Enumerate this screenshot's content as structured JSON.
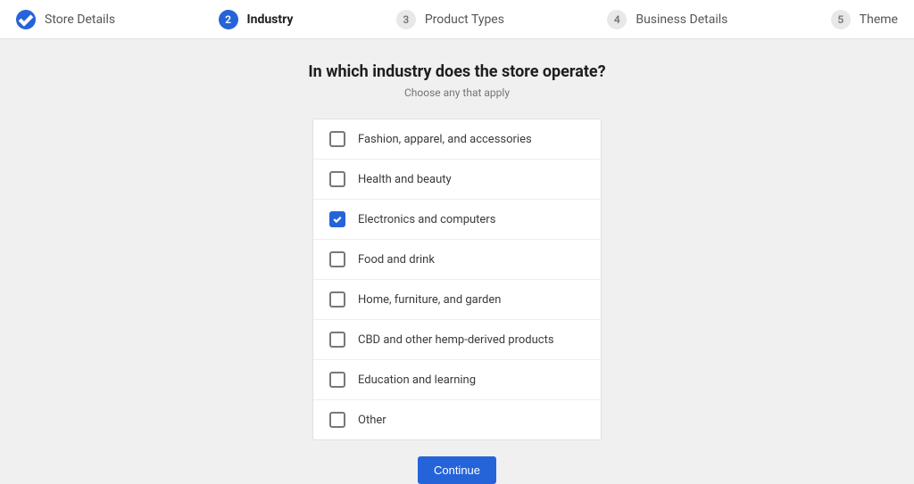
{
  "stepper": {
    "steps": [
      {
        "num": "1",
        "label": "Store Details",
        "state": "completed"
      },
      {
        "num": "2",
        "label": "Industry",
        "state": "active"
      },
      {
        "num": "3",
        "label": "Product Types",
        "state": "pending"
      },
      {
        "num": "4",
        "label": "Business Details",
        "state": "pending"
      },
      {
        "num": "5",
        "label": "Theme",
        "state": "pending"
      }
    ]
  },
  "heading": {
    "title": "In which industry does the store operate?",
    "subtitle": "Choose any that apply"
  },
  "options": [
    {
      "label": "Fashion, apparel, and accessories",
      "checked": false
    },
    {
      "label": "Health and beauty",
      "checked": false
    },
    {
      "label": "Electronics and computers",
      "checked": true
    },
    {
      "label": "Food and drink",
      "checked": false
    },
    {
      "label": "Home, furniture, and garden",
      "checked": false
    },
    {
      "label": "CBD and other hemp-derived products",
      "checked": false
    },
    {
      "label": "Education and learning",
      "checked": false
    },
    {
      "label": "Other",
      "checked": false
    }
  ],
  "actions": {
    "continue_label": "Continue"
  }
}
